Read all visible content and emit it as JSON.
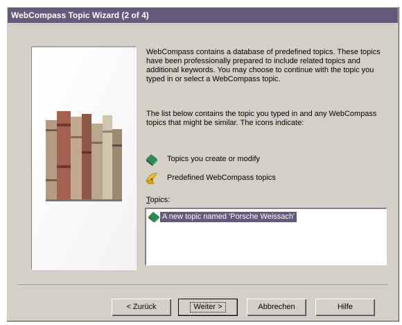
{
  "window": {
    "title": "WebCompass Topic Wizard (2 of 4)"
  },
  "intro": {
    "paragraph1": "WebCompass contains a database of predefined topics. These topics have been professionally prepared to include related topics and additional keywords. You may choose to continue with the topic you typed in or select a WebCompass topic.",
    "paragraph2": "The list below contains the topic you typed in and any WebCompass topics that might be similar. The icons indicate:"
  },
  "legend": [
    {
      "icon": "green-book-icon",
      "label": "Topics you create or modify"
    },
    {
      "icon": "yellow-compass-icon",
      "label": "Predefined WebCompass topics"
    }
  ],
  "topics": {
    "label_accel": "T",
    "label_rest": "opics:",
    "items": [
      {
        "icon": "green-book-icon",
        "label": "A new topic named 'Porsche Weissach'",
        "selected": true
      }
    ]
  },
  "buttons": {
    "back": "< Zurück",
    "next": "Weiter >",
    "cancel": "Abbrechen",
    "help": "Hilfe"
  },
  "colors": {
    "title_bar": "#645a7c",
    "selection": "#645a7c",
    "dialog_face": "#d4d0c8"
  }
}
